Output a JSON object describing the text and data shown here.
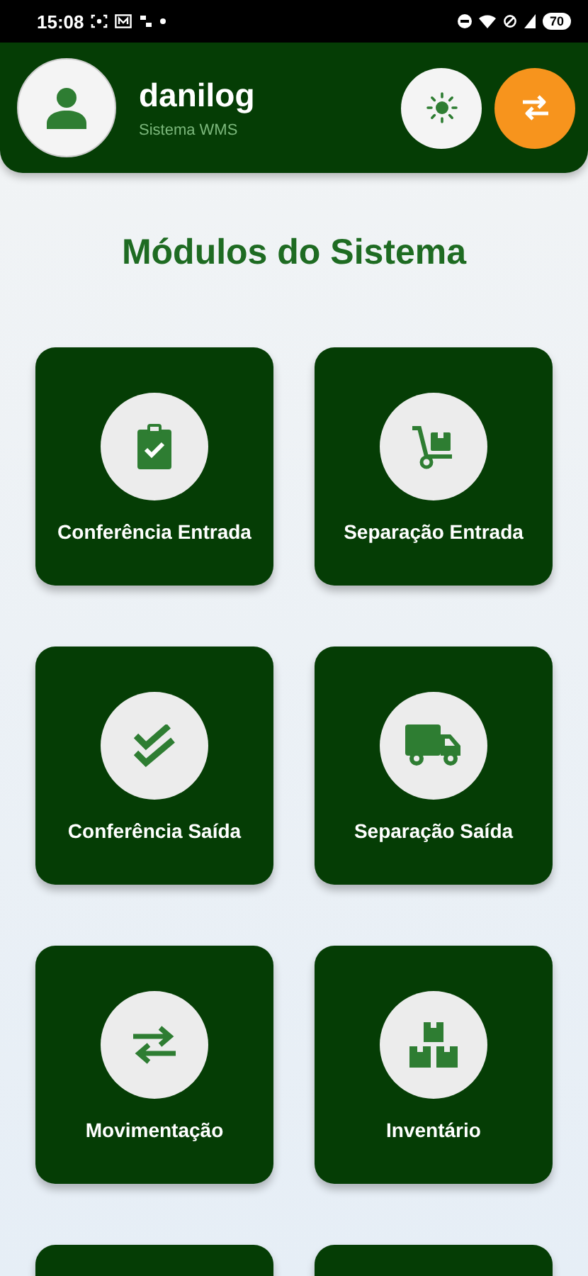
{
  "status_bar": {
    "time": "15:08",
    "battery": "70"
  },
  "header": {
    "user_name": "danilog",
    "subtitle": "Sistema WMS"
  },
  "title": "Módulos do Sistema",
  "modules": [
    {
      "kind": "clipboard",
      "label": "Conferência Entrada"
    },
    {
      "kind": "cart",
      "label": "Separação Entrada"
    },
    {
      "kind": "double-check",
      "label": "Conferência Saída"
    },
    {
      "kind": "truck",
      "label": "Separação Saída"
    },
    {
      "kind": "arrows",
      "label": "Movimentação"
    },
    {
      "kind": "boxes",
      "label": "Inventário"
    },
    {
      "kind": "cut"
    },
    {
      "kind": "cut"
    }
  ]
}
